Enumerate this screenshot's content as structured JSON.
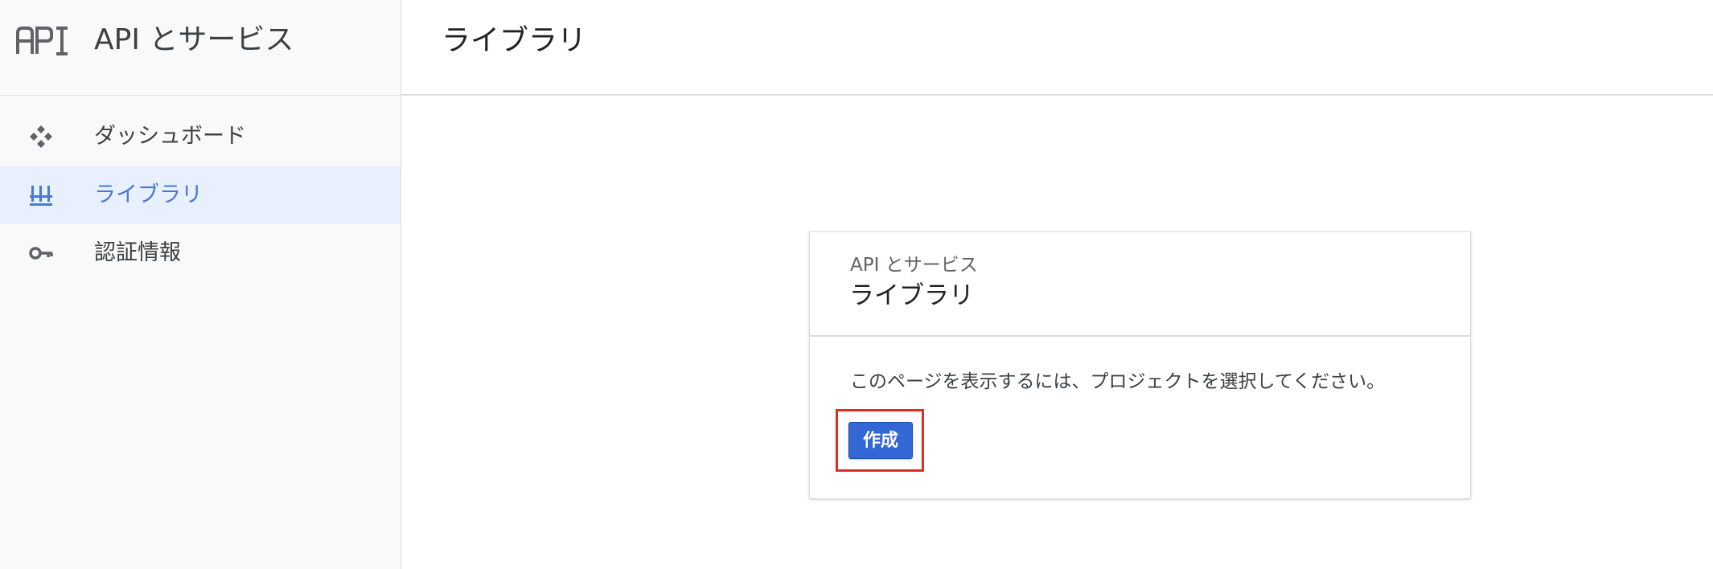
{
  "sidebar": {
    "logo_text": "API",
    "app_title": "API とサービス",
    "items": [
      {
        "label": "ダッシュボード",
        "icon": "dashboard-icon",
        "active": false
      },
      {
        "label": "ライブラリ",
        "icon": "library-icon",
        "active": true
      },
      {
        "label": "認証情報",
        "icon": "key-icon",
        "active": false
      }
    ]
  },
  "header": {
    "title": "ライブラリ"
  },
  "card": {
    "subtitle": "API とサービス",
    "title": "ライブラリ",
    "message": "このページを表示するには、プロジェクトを選択してください。",
    "create_label": "作成"
  },
  "colors": {
    "accent": "#3367d6",
    "active_bg": "#e8f0fe",
    "highlight": "#d93025"
  }
}
